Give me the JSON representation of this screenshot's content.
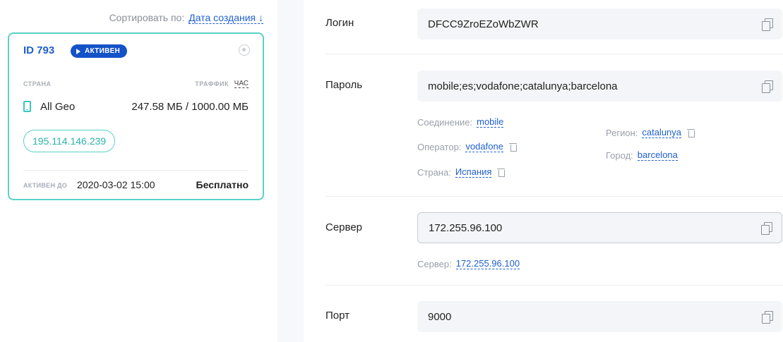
{
  "sort": {
    "label": "Сортировать по:",
    "value": "Дата создания ↓"
  },
  "card": {
    "id_label": "ID 793",
    "status": "АКТИВЕН",
    "country_label": "СТРАНА",
    "traffic_label": "ТРАФФИК",
    "traffic_period": "ЧАС",
    "geo": "All Geo",
    "traffic": "247.58 МБ / 1000.00 МБ",
    "ip": "195.114.146.239",
    "active_until_label": "АКТИВЕН ДО",
    "active_until": "2020-03-02 15:00",
    "price": "Бесплатно"
  },
  "form": {
    "login": {
      "label": "Логин",
      "value": "DFCC9ZroEZoWbZWR"
    },
    "password": {
      "label": "Пароль",
      "value": "mobile;es;vodafone;catalunya;barcelona",
      "connection_label": "Соединение:",
      "connection": "mobile",
      "operator_label": "Оператор:",
      "operator": "vodafone",
      "country_label": "Страна:",
      "country": "Испания",
      "region_label": "Регион:",
      "region": "catalunya",
      "city_label": "Город:",
      "city": "barcelona"
    },
    "server": {
      "label": "Сервер",
      "value": "172.255.96.100",
      "hint_label": "Сервер:",
      "hint_value": "172.255.96.100"
    },
    "port": {
      "label": "Порт",
      "value": "9000"
    }
  },
  "colors": {
    "accent": "#1f5fd1",
    "badge": "#1452c7",
    "teal": "#5ad1c9"
  }
}
